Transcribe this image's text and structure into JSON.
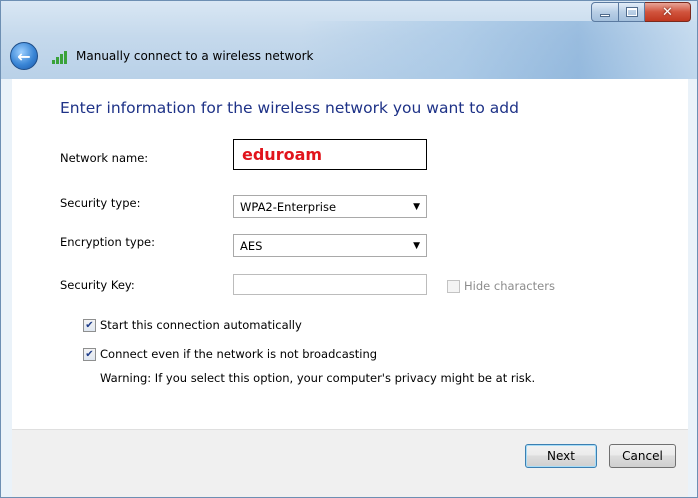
{
  "window": {
    "title": "Manually connect to a wireless network"
  },
  "page": {
    "heading": "Enter information for the wireless network you want to add"
  },
  "form": {
    "network_name": {
      "label": "Network name:",
      "value": "eduroam"
    },
    "security_type": {
      "label": "Security type:",
      "value": "WPA2-Enterprise"
    },
    "encryption_type": {
      "label": "Encryption type:",
      "value": "AES"
    },
    "security_key": {
      "label": "Security Key:",
      "value": ""
    },
    "hide_characters": {
      "label": "Hide characters",
      "checked": false,
      "enabled": false
    },
    "start_automatically": {
      "label": "Start this connection automatically",
      "checked": true
    },
    "connect_not_broadcasting": {
      "label": "Connect even if the network is not broadcasting",
      "checked": true
    },
    "warning": "Warning: If you select this option, your computer's privacy might be at risk."
  },
  "buttons": {
    "next": "Next",
    "cancel": "Cancel"
  },
  "colors": {
    "heading": "#1e3287",
    "network_name_text": "#e1141c"
  }
}
